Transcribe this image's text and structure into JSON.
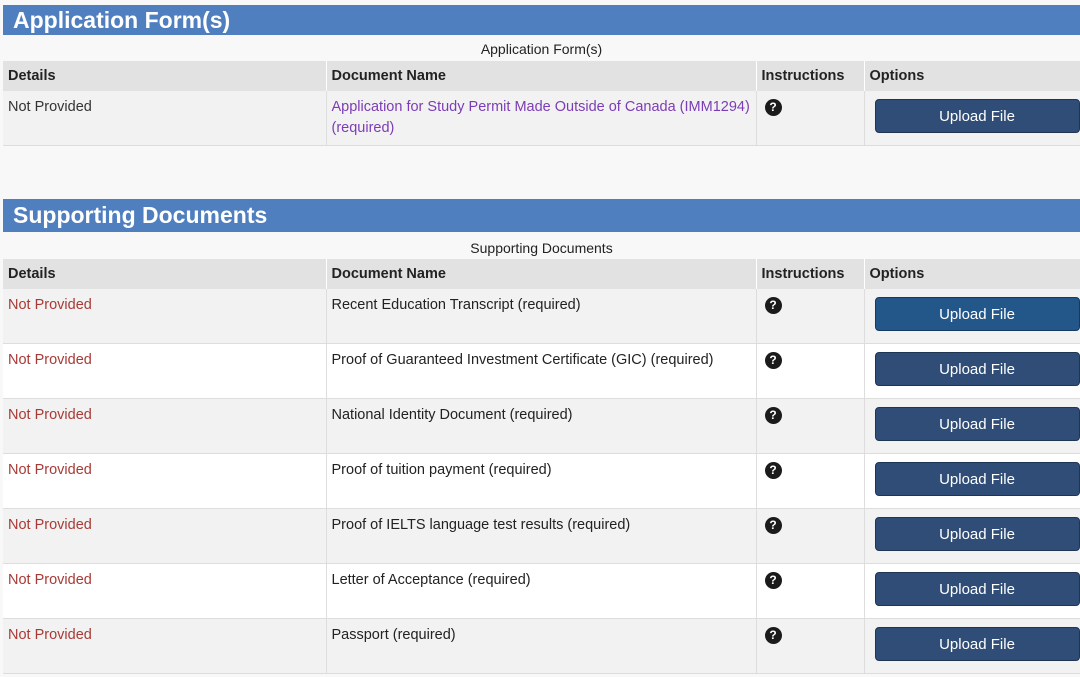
{
  "application_forms": {
    "header": "Application Form(s)",
    "caption": "Application Form(s)",
    "columns": [
      "Details",
      "Document Name",
      "Instructions",
      "Options"
    ],
    "rows": [
      {
        "details": "Not Provided",
        "document": "Application for Study Permit Made Outside of Canada (IMM1294)  (required)",
        "button": "Upload File"
      }
    ]
  },
  "supporting_documents": {
    "header": "Supporting Documents",
    "caption": "Supporting Documents",
    "columns": [
      "Details",
      "Document Name",
      "Instructions",
      "Options"
    ],
    "rows": [
      {
        "details": "Not Provided",
        "document": "Recent Education Transcript  (required)",
        "button": "Upload File"
      },
      {
        "details": "Not Provided",
        "document": "Proof of Guaranteed Investment Certificate (GIC)  (required)",
        "button": "Upload File"
      },
      {
        "details": "Not Provided",
        "document": "National Identity Document  (required)",
        "button": "Upload File"
      },
      {
        "details": "Not Provided",
        "document": "Proof of tuition payment  (required)",
        "button": "Upload File"
      },
      {
        "details": "Not Provided",
        "document": "Proof of IELTS language test results  (required)",
        "button": "Upload File"
      },
      {
        "details": "Not Provided",
        "document": "Letter of Acceptance  (required)",
        "button": "Upload File"
      },
      {
        "details": "Not Provided",
        "document": "Passport  (required)",
        "button": "Upload File"
      }
    ]
  },
  "icons": {
    "instructions": "question-circle-icon",
    "help_glyph": "?"
  },
  "colors": {
    "header_bg": "#4f7fbf",
    "button_bg": "#2f4d76",
    "status_red": "#a83a35",
    "link_purple": "#7b3db5"
  }
}
